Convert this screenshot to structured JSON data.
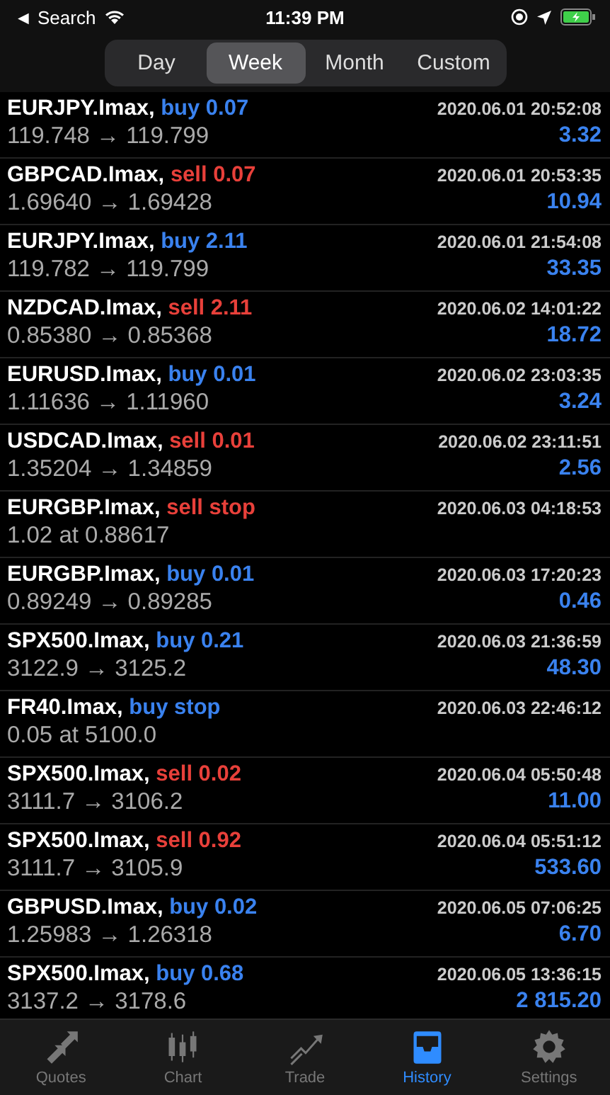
{
  "status_bar": {
    "back": "◄ Search",
    "time": "11:39 PM"
  },
  "periods": [
    {
      "label": "Day",
      "selected": false
    },
    {
      "label": "Week",
      "selected": true
    },
    {
      "label": "Month",
      "selected": false
    },
    {
      "label": "Custom",
      "selected": false
    }
  ],
  "deals": [
    {
      "symbol": "EURJPY.Imax,",
      "kind": "buy",
      "order": "buy 0.07",
      "prices": "119.748 → 119.799",
      "time": "2020.06.01 20:52:08",
      "profit": "3.32"
    },
    {
      "symbol": "GBPCAD.Imax,",
      "kind": "sell",
      "order": "sell 0.07",
      "prices": "1.69640 → 1.69428",
      "time": "2020.06.01 20:53:35",
      "profit": "10.94"
    },
    {
      "symbol": "EURJPY.Imax,",
      "kind": "buy",
      "order": "buy 2.11",
      "prices": "119.782 → 119.799",
      "time": "2020.06.01 21:54:08",
      "profit": "33.35"
    },
    {
      "symbol": "NZDCAD.Imax,",
      "kind": "sell",
      "order": "sell 2.11",
      "prices": "0.85380 → 0.85368",
      "time": "2020.06.02 14:01:22",
      "profit": "18.72"
    },
    {
      "symbol": "EURUSD.Imax,",
      "kind": "buy",
      "order": "buy 0.01",
      "prices": "1.11636 → 1.11960",
      "time": "2020.06.02 23:03:35",
      "profit": "3.24"
    },
    {
      "symbol": "USDCAD.Imax,",
      "kind": "sell",
      "order": "sell 0.01",
      "prices": "1.35204 → 1.34859",
      "time": "2020.06.02 23:11:51",
      "profit": "2.56"
    },
    {
      "symbol": "EURGBP.Imax,",
      "kind": "sell",
      "order": "sell stop",
      "prices": "1.02 at 0.88617",
      "time": "2020.06.03 04:18:53"
    },
    {
      "symbol": "EURGBP.Imax,",
      "kind": "buy",
      "order": "buy 0.01",
      "prices": "0.89249 → 0.89285",
      "time": "2020.06.03 17:20:23",
      "profit": "0.46"
    },
    {
      "symbol": "SPX500.Imax,",
      "kind": "buy",
      "order": "buy 0.21",
      "prices": "3122.9 → 3125.2",
      "time": "2020.06.03 21:36:59",
      "profit": "48.30"
    },
    {
      "symbol": "FR40.Imax,",
      "kind": "buy",
      "order": "buy stop",
      "prices": "0.05 at 5100.0",
      "time": "2020.06.03 22:46:12"
    },
    {
      "symbol": "SPX500.Imax,",
      "kind": "sell",
      "order": "sell 0.02",
      "prices": "3111.7 → 3106.2",
      "time": "2020.06.04 05:50:48",
      "profit": "11.00"
    },
    {
      "symbol": "SPX500.Imax,",
      "kind": "sell",
      "order": "sell 0.92",
      "prices": "3111.7 → 3105.9",
      "time": "2020.06.04 05:51:12",
      "profit": "533.60"
    },
    {
      "symbol": "GBPUSD.Imax,",
      "kind": "buy",
      "order": "buy 0.02",
      "prices": "1.25983 → 1.26318",
      "time": "2020.06.05 07:06:25",
      "profit": "6.70"
    },
    {
      "symbol": "SPX500.Imax,",
      "kind": "buy",
      "order": "buy 0.68",
      "prices": "3137.2 → 3178.6",
      "time": "2020.06.05 13:36:15",
      "profit": "2 815.20"
    }
  ],
  "tabs": [
    {
      "kind": "quotes",
      "label": "Quotes",
      "selected": false
    },
    {
      "kind": "chart",
      "label": "Chart",
      "selected": false
    },
    {
      "kind": "trade",
      "label": "Trade",
      "selected": false
    },
    {
      "kind": "history",
      "label": "History",
      "selected": true
    },
    {
      "kind": "settings",
      "label": "Settings",
      "selected": false
    }
  ]
}
